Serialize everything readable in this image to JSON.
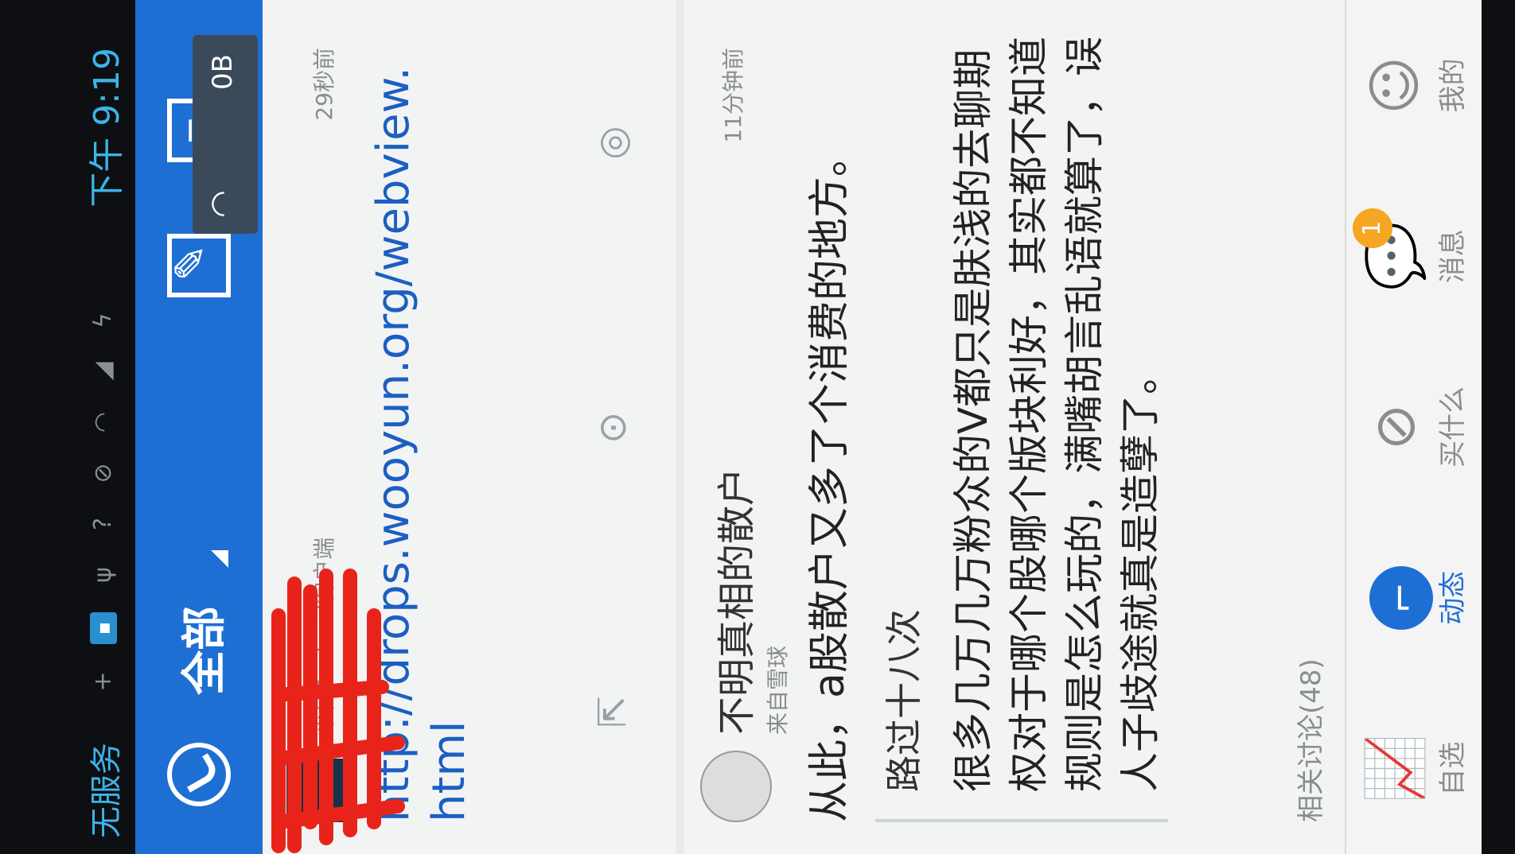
{
  "statusbar": {
    "carrier": "无服务",
    "time": "下午 9:19",
    "network_speed": "0B"
  },
  "appbar": {
    "filter_label": "全部"
  },
  "posts": [
    {
      "source": "来自Android客户端",
      "time_ago": "29秒前",
      "link_text": "http://drops.wooyun.org/webview.html"
    },
    {
      "username": "不明真相的散户",
      "source": "来自雪球",
      "time_ago": "11分钟前",
      "text": "从此，a股散户又多了个消费的地方。",
      "quoted_user": "路过十八次",
      "quoted_text": "很多几万几万粉众的V都只是肤浅的去聊期权对于哪个股哪个版块利好，其实都不知道规则是怎么玩的，满嘴胡言乱语就算了，误人子歧途就真是造孽了。",
      "related_label": "相关讨论(48)"
    }
  ],
  "tabbar": {
    "tabs": [
      {
        "label": "自选",
        "icon": "chart-line-icon"
      },
      {
        "label": "动态",
        "icon": "feed-icon",
        "active": true
      },
      {
        "label": "买什么",
        "icon": "compass-icon"
      },
      {
        "label": "消息",
        "icon": "chat-icon",
        "badge": "1"
      },
      {
        "label": "我的",
        "icon": "user-icon"
      }
    ]
  },
  "colors": {
    "brand_blue": "#1e6fd4",
    "link_blue": "#1b5fc1",
    "badge_orange": "#f5a623",
    "annotation_red": "#e8241a"
  }
}
